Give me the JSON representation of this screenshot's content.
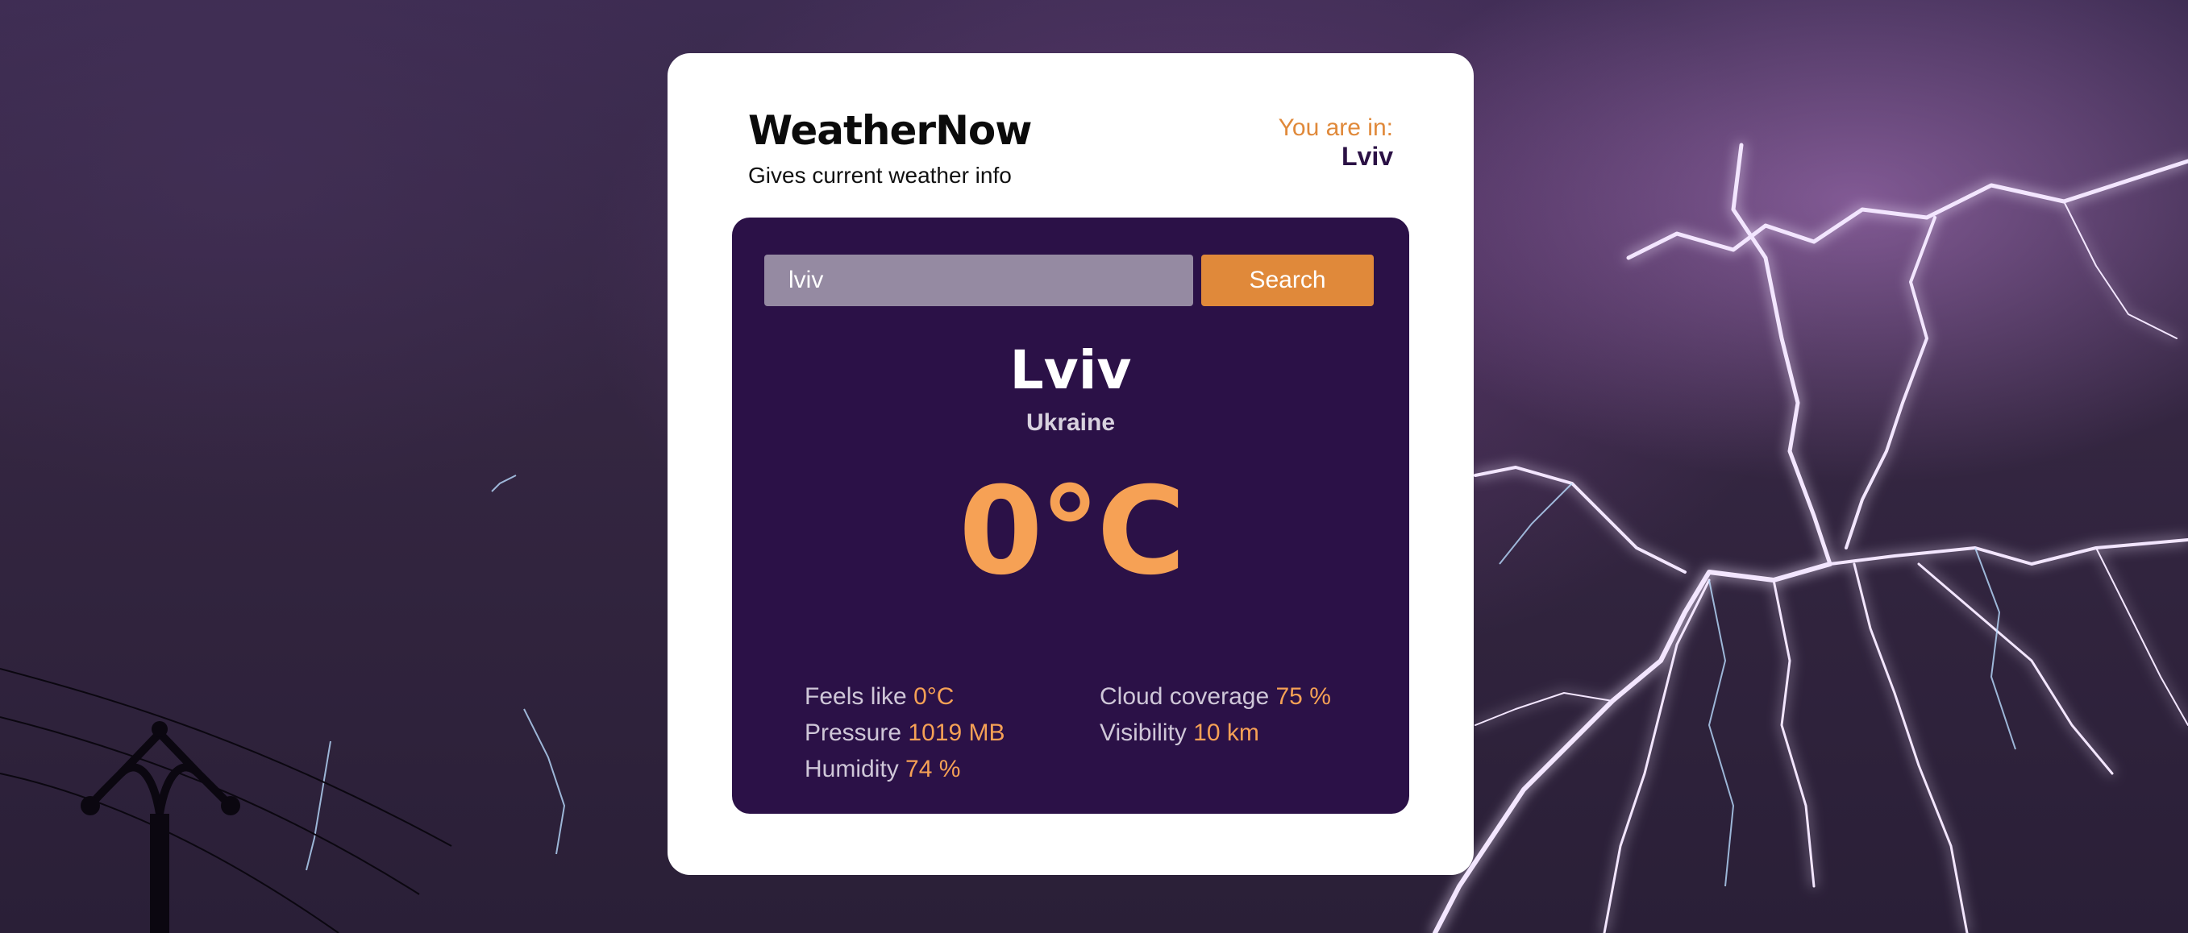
{
  "app": {
    "title": "WeatherNow",
    "subtitle": "Gives current weather info"
  },
  "location": {
    "label": "You are in:",
    "city": "Lviv"
  },
  "search": {
    "value": "lviv",
    "placeholder": "",
    "button_label": "Search"
  },
  "weather": {
    "city": "Lviv",
    "country": "Ukraine",
    "temperature": "0°C",
    "details": {
      "feels_like_label": "Feels like",
      "feels_like_value": "0°C",
      "pressure_label": "Pressure",
      "pressure_value": "1019 MB",
      "humidity_label": "Humidity",
      "humidity_value": "74 %",
      "cloud_label": "Cloud coverage",
      "cloud_value": "75 %",
      "visibility_label": "Visibility",
      "visibility_value": "10 km"
    }
  },
  "colors": {
    "accent": "#e0893a",
    "temperature": "#f6a155",
    "panel": "#2b1147",
    "brand_dark": "#2b1145"
  },
  "background": {
    "image": "lightning storm with power pole silhouette"
  }
}
